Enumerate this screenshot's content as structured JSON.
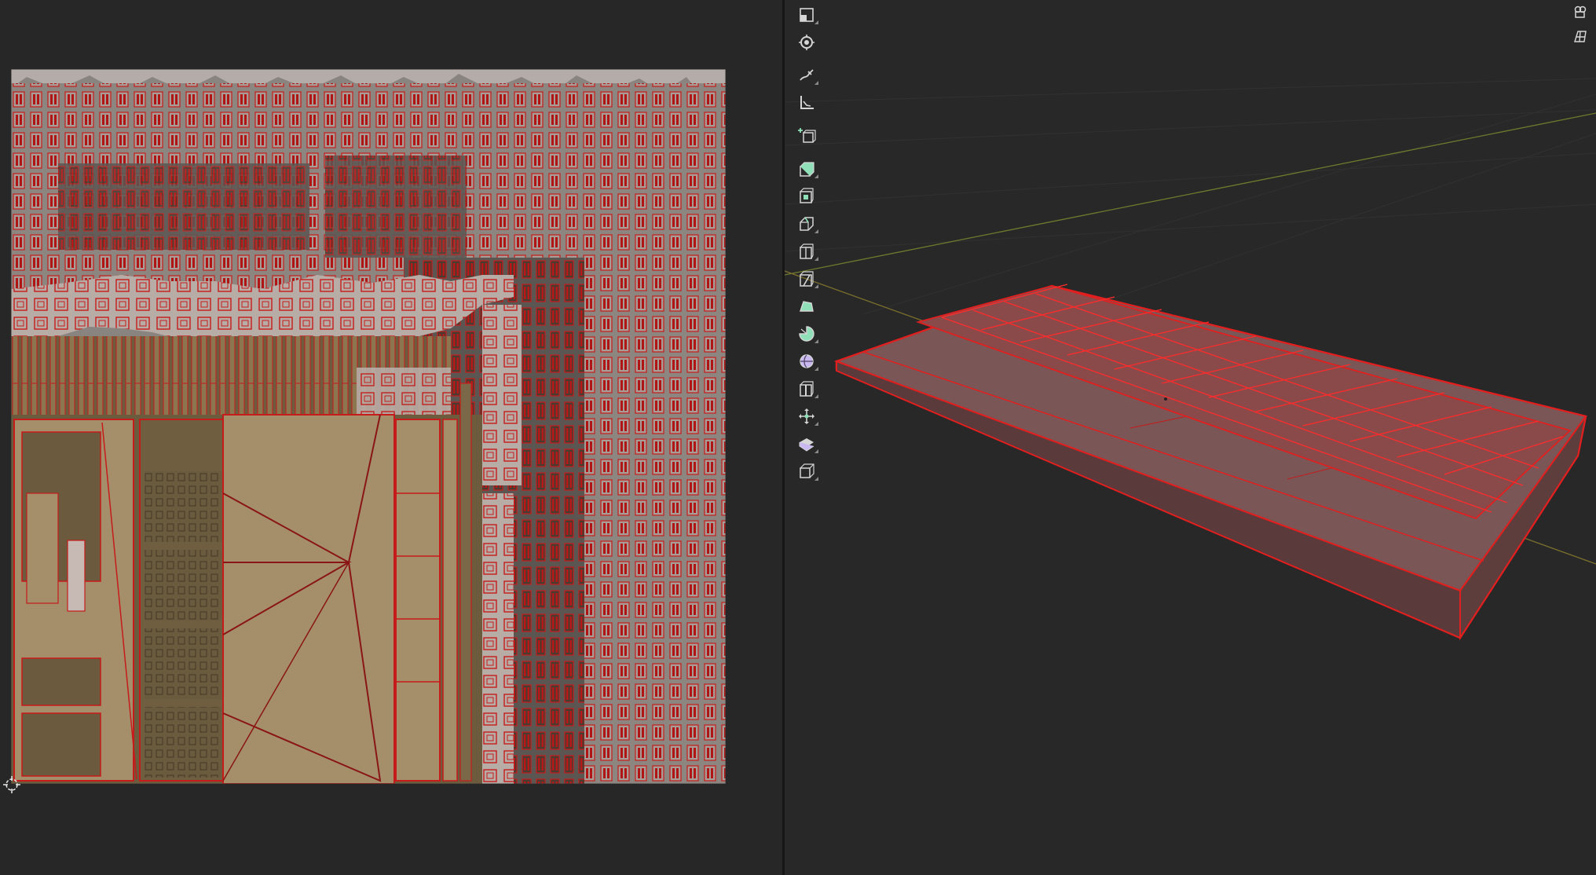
{
  "colors": {
    "background": "#282828",
    "uv_island_fill": "#a48f6a",
    "uv_island_dark": "#6f5e40",
    "uv_edge": "#c61b1b",
    "mesh_fill": "#7a4a4a",
    "mesh_edge": "#e21f1f",
    "tool_icon": "#d6d6d6",
    "tool_icon_accent": "#8fe0b8",
    "grid_line": "#333333",
    "axis_x": "#7a2d2d",
    "axis_y": "#6f7a2d"
  },
  "uv_editor": {
    "image_icon": "uv-texture-atlas",
    "cursor_icon": "2d-cursor-icon"
  },
  "toolbar": {
    "tools": [
      {
        "name": "select-box",
        "icon": "select-box-icon"
      },
      {
        "name": "cursor",
        "icon": "cursor-icon"
      },
      {
        "name": "annotate",
        "icon": "annotate-icon"
      },
      {
        "name": "measure",
        "icon": "measure-icon"
      },
      {
        "name": "add-cube",
        "icon": "add-cube-icon"
      },
      {
        "name": "extrude-region",
        "icon": "extrude-icon"
      },
      {
        "name": "inset-faces",
        "icon": "inset-icon"
      },
      {
        "name": "bevel",
        "icon": "bevel-icon"
      },
      {
        "name": "loop-cut",
        "icon": "loop-cut-icon"
      },
      {
        "name": "knife",
        "icon": "knife-icon"
      },
      {
        "name": "poly-build",
        "icon": "poly-build-icon"
      },
      {
        "name": "spin",
        "icon": "spin-icon"
      },
      {
        "name": "smooth",
        "icon": "smooth-icon"
      },
      {
        "name": "edge-slide",
        "icon": "edge-slide-icon"
      },
      {
        "name": "shrink-fatten",
        "icon": "shrink-fatten-icon"
      },
      {
        "name": "shear",
        "icon": "shear-icon"
      },
      {
        "name": "rip-region",
        "icon": "rip-icon"
      }
    ]
  },
  "navigation": {
    "buttons": [
      {
        "name": "view-camera",
        "icon": "camera-view-icon"
      },
      {
        "name": "toggle-perspective",
        "icon": "grid-icon"
      }
    ]
  }
}
